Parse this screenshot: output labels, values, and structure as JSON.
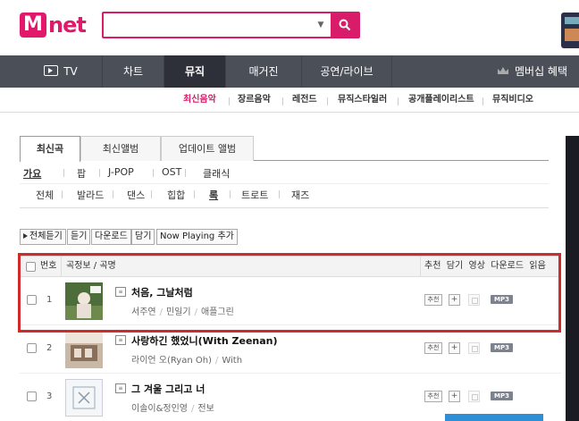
{
  "header": {
    "logo_m": "M",
    "logo_text": "net",
    "search": {
      "value": "",
      "placeholder": ""
    }
  },
  "nav": {
    "items": [
      {
        "label": "TV"
      },
      {
        "label": "차트"
      },
      {
        "label": "뮤직"
      },
      {
        "label": "매거진"
      },
      {
        "label": "공연/라이브"
      }
    ],
    "membership": "멤버십 혜택"
  },
  "subnav": {
    "items": [
      "최신음악",
      "장르음악",
      "레전드",
      "뮤직스타일러",
      "공개플레이리스트",
      "뮤직비디오"
    ]
  },
  "tabs": [
    "최신곡",
    "최신앨범",
    "업데이트 앨범"
  ],
  "genres": [
    "가요",
    "팝",
    "J-POP",
    "OST",
    "클래식"
  ],
  "sub_genres": [
    "전체",
    "발라드",
    "댄스",
    "힙합",
    "록",
    "트로트",
    "재즈"
  ],
  "toolbar": {
    "play_all": "전체듣기",
    "listen": "듣기",
    "download": "다운로드",
    "save": "담기",
    "now_playing": "Now Playing 추가"
  },
  "table": {
    "headers": {
      "number": "번호",
      "song_info": "곡정보 / 곡명",
      "actions": "추천  담기  영상  다운로드  읽음"
    },
    "rows": [
      {
        "number": "1",
        "title": "처음, 그날처럼",
        "artist": "서주연",
        "album": "민일기",
        "genre": "애플그린",
        "rec": "추천",
        "add": "+",
        "mp3": "MP3"
      },
      {
        "number": "2",
        "title": "사랑하긴 했었니(With Zeenan)",
        "artist": "라이언 오(Ryan Oh)",
        "album": "With",
        "rec": "추천",
        "add": "+",
        "mp3": "MP3"
      },
      {
        "number": "3",
        "title": "그 겨울 그리고 너",
        "artist": "이솔이&정인영",
        "album": "전보",
        "rec": "추천",
        "add": "+",
        "mp3": "MP3"
      }
    ]
  },
  "colors": {
    "brand": "#e2196a",
    "nav_bg": "#4b4f58",
    "highlight": "#d12a2a"
  }
}
